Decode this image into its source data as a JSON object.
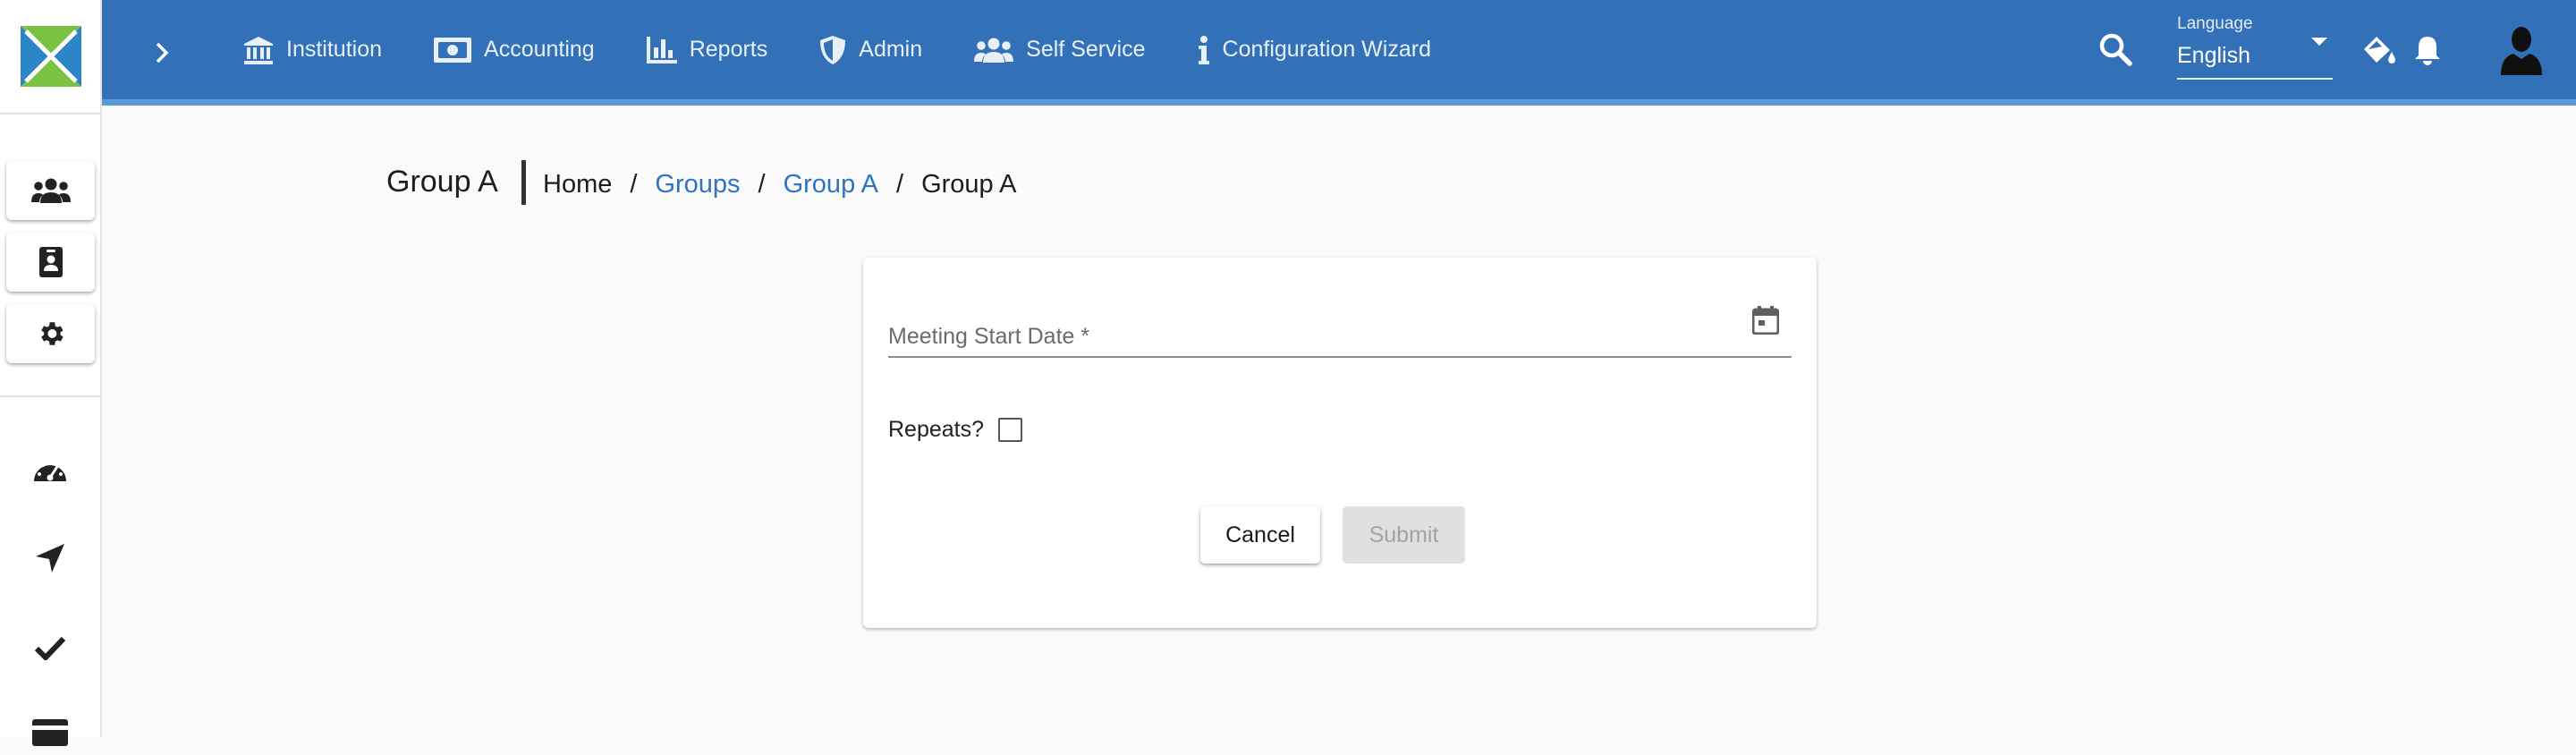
{
  "topbar": {
    "nav": [
      {
        "label": "Institution",
        "icon": "bank-icon"
      },
      {
        "label": "Accounting",
        "icon": "money-icon"
      },
      {
        "label": "Reports",
        "icon": "bar-chart-icon"
      },
      {
        "label": "Admin",
        "icon": "shield-icon"
      },
      {
        "label": "Self Service",
        "icon": "people-icon"
      },
      {
        "label": "Configuration Wizard",
        "icon": "info-icon"
      }
    ],
    "language": {
      "label": "Language",
      "value": "English"
    }
  },
  "rail": {
    "buttons": [
      "groups-icon",
      "contact-card-icon",
      "gear-icon"
    ],
    "icons": [
      "dashboard-icon",
      "navigation-icon",
      "check-icon",
      "card-icon"
    ]
  },
  "page": {
    "title": "Group A",
    "breadcrumb": [
      {
        "label": "Home",
        "link": false
      },
      {
        "label": "Groups",
        "link": true
      },
      {
        "label": "Group A",
        "link": true
      },
      {
        "label": "Group A",
        "link": false
      }
    ],
    "separator": "/"
  },
  "form": {
    "date_placeholder": "Meeting Start Date *",
    "repeats_label": "Repeats?",
    "repeats_checked": false,
    "cancel_label": "Cancel",
    "submit_label": "Submit"
  },
  "colors": {
    "primary": "#3271b7",
    "link": "#2f74c0",
    "disabled_bg": "#e0e0e0"
  }
}
